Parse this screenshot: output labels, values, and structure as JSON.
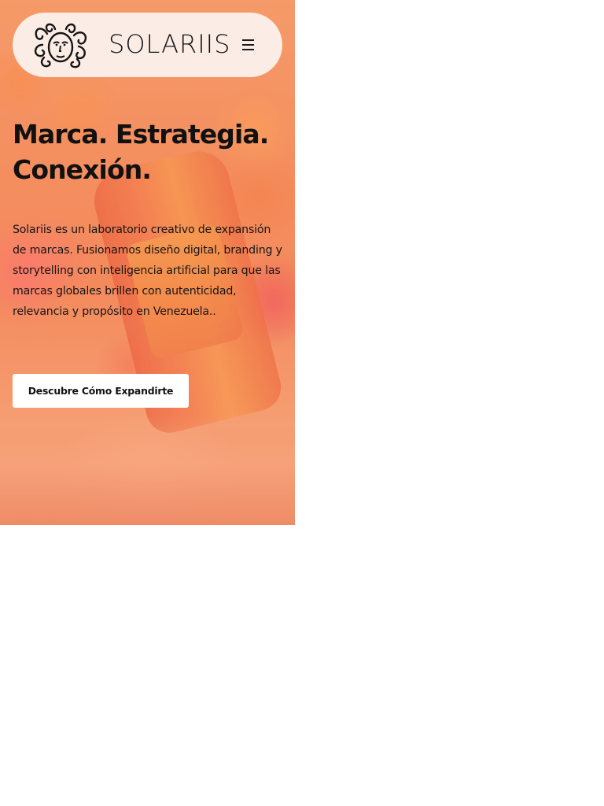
{
  "brand": {
    "name": "Solariis",
    "wordmark": "SOLARIIS",
    "logo_icon": "medusa-head-icon"
  },
  "nav": {
    "menu_icon": "hamburger-menu-icon"
  },
  "hero": {
    "headline_line1": "Marca. Estrategia.",
    "headline_line2": "Conexión.",
    "description": "Solariis es un laboratorio creativo de expansión de marcas. Fusionamos diseño digital, branding y storytelling con inteligencia artificial para que las marcas globales brillen con autenticidad, relevancia y propósito en Venezuela..",
    "cta_label": "Descubre Cómo Expandirte",
    "background_image": "orange soda can on sand with fuzzy character puffs"
  },
  "colors": {
    "nav_bg": "#fbece6",
    "hero_tint": "#ef8a5e",
    "text": "#111111",
    "cta_bg": "#ffffff"
  }
}
